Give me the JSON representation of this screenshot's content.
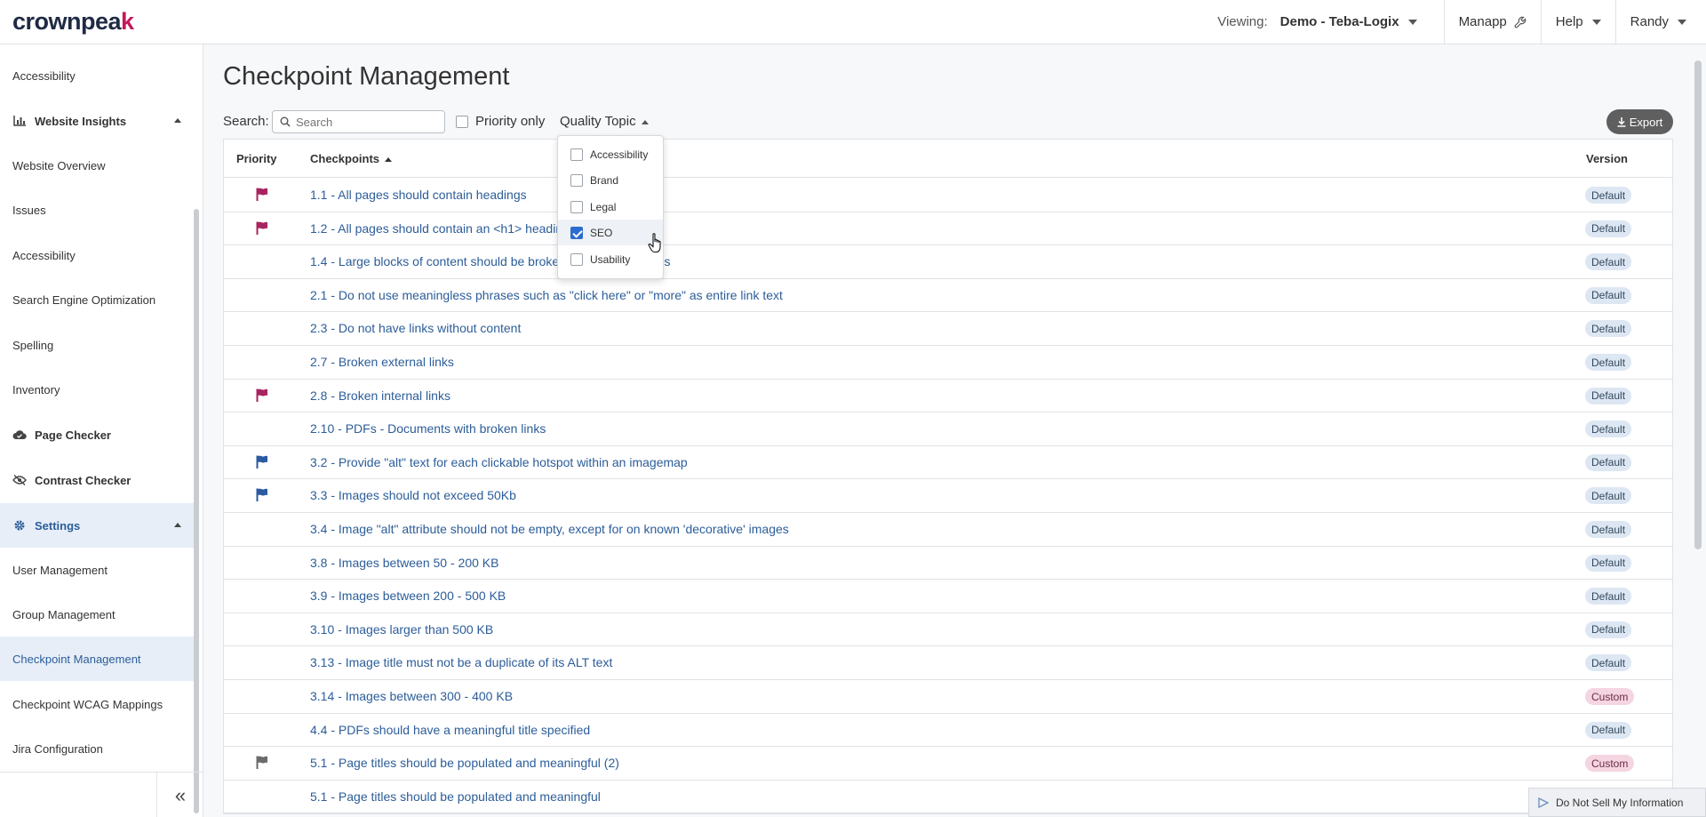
{
  "brand": {
    "logo_main": "crownpea",
    "logo_accent": "k"
  },
  "topnav": {
    "viewing_label": "Viewing:",
    "viewing_value": "Demo - Teba-Logix",
    "manapp": "Manapp",
    "help": "Help",
    "user": "Randy"
  },
  "sidebar": {
    "items": [
      {
        "label": "Accessibility",
        "type": "page"
      },
      {
        "label": "Website Insights",
        "type": "group",
        "icon": "bar-chart-icon"
      },
      {
        "label": "Website Overview",
        "type": "page"
      },
      {
        "label": "Issues",
        "type": "page"
      },
      {
        "label": "Accessibility",
        "type": "page"
      },
      {
        "label": "Search Engine Optimization",
        "type": "page"
      },
      {
        "label": "Spelling",
        "type": "page"
      },
      {
        "label": "Inventory",
        "type": "page"
      },
      {
        "label": "Page Checker",
        "type": "group",
        "icon": "cloud-check-icon"
      },
      {
        "label": "Contrast Checker",
        "type": "group",
        "icon": "eye-slash-icon"
      },
      {
        "label": "Settings",
        "type": "group",
        "icon": "gear-icon"
      },
      {
        "label": "User Management",
        "type": "page"
      },
      {
        "label": "Group Management",
        "type": "page"
      },
      {
        "label": "Checkpoint Management",
        "type": "page"
      },
      {
        "label": "Checkpoint WCAG Mappings",
        "type": "page"
      },
      {
        "label": "Jira Configuration",
        "type": "page"
      }
    ],
    "collapse_label": "«"
  },
  "main": {
    "title": "Checkpoint Management",
    "search_label": "Search:",
    "search_placeholder": "Search",
    "priority_only": "Priority only",
    "quality_topic": "Quality Topic",
    "export": "Export"
  },
  "table": {
    "headers": {
      "priority": "Priority",
      "checkpoints": "Checkpoints",
      "version": "Version"
    },
    "rows": [
      {
        "flag": "pink",
        "checkpoint": "1.1 - All pages should contain headings",
        "version": "Default"
      },
      {
        "flag": "pink",
        "checkpoint": "1.2 - All pages should contain an <h1> heading",
        "version": "Default"
      },
      {
        "flag": "",
        "checkpoint": "1.4 - Large blocks of content should be broken up using headings",
        "version": "Default"
      },
      {
        "flag": "",
        "checkpoint": "2.1 - Do not use meaningless phrases such as \"click here\" or \"more\" as entire link text",
        "version": "Default"
      },
      {
        "flag": "",
        "checkpoint": "2.3 - Do not have links without content",
        "version": "Default"
      },
      {
        "flag": "",
        "checkpoint": "2.7 - Broken external links",
        "version": "Default"
      },
      {
        "flag": "pink",
        "checkpoint": "2.8 - Broken internal links",
        "version": "Default"
      },
      {
        "flag": "",
        "checkpoint": "2.10 - PDFs - Documents with broken links",
        "version": "Default"
      },
      {
        "flag": "blue",
        "checkpoint": "3.2 - Provide \"alt\" text for each clickable hotspot within an imagemap",
        "version": "Default"
      },
      {
        "flag": "blue",
        "checkpoint": "3.3 - Images should not exceed 50Kb",
        "version": "Default"
      },
      {
        "flag": "",
        "checkpoint": "3.4 - Image \"alt\" attribute should not be empty, except for on known 'decorative' images",
        "version": "Default"
      },
      {
        "flag": "",
        "checkpoint": "3.8 - Images between 50 - 200 KB",
        "version": "Default"
      },
      {
        "flag": "",
        "checkpoint": "3.9 - Images between 200 - 500 KB",
        "version": "Default"
      },
      {
        "flag": "",
        "checkpoint": "3.10 - Images larger than 500 KB",
        "version": "Default"
      },
      {
        "flag": "",
        "checkpoint": "3.13 - Image title must not be a duplicate of its ALT text",
        "version": "Default"
      },
      {
        "flag": "",
        "checkpoint": "3.14 - Images between 300 - 400 KB",
        "version": "Custom"
      },
      {
        "flag": "",
        "checkpoint": "4.4 - PDFs should have a meaningful title specified",
        "version": "Default"
      },
      {
        "flag": "gray",
        "checkpoint": "5.1 - Page titles should be populated and meaningful (2)",
        "version": "Custom"
      },
      {
        "flag": "",
        "checkpoint": "5.1 - Page titles should be populated and meaningful",
        "version": ""
      }
    ]
  },
  "dropdown": {
    "options": [
      {
        "label": "Accessibility",
        "checked": false
      },
      {
        "label": "Brand",
        "checked": false
      },
      {
        "label": "Legal",
        "checked": false
      },
      {
        "label": "SEO",
        "checked": true
      },
      {
        "label": "Usability",
        "checked": false
      }
    ]
  },
  "footer_badge": "Do Not Sell My Information",
  "colors": {
    "flag_pink": "#a8245f",
    "flag_blue": "#2b5aa0",
    "flag_gray": "#6b6b6b",
    "link": "#2c5d99"
  }
}
